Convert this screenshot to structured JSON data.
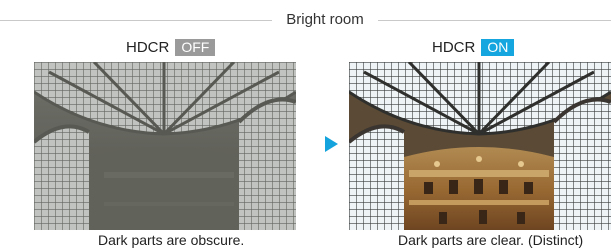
{
  "header": {
    "title": "Bright room"
  },
  "panels": {
    "off": {
      "label": "HDCR",
      "state": "OFF",
      "caption": "Dark parts are obscure.",
      "badge_color": "#9a9a9a"
    },
    "on": {
      "label": "HDCR",
      "state": "ON",
      "caption": "Dark parts are clear. (Distinct)",
      "badge_color": "#15a6df"
    }
  },
  "arrow": {
    "icon": "play-arrow-icon",
    "color": "#14a3dd"
  }
}
